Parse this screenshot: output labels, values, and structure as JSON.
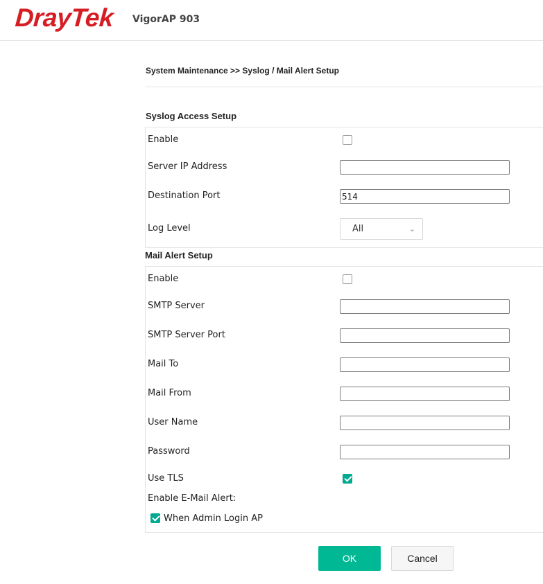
{
  "header": {
    "brand": "DrayTek",
    "model": "VigorAP 903"
  },
  "breadcrumb": "System Maintenance >> Syslog / Mail Alert Setup",
  "syslog": {
    "title": "Syslog Access Setup",
    "enable_label": "Enable",
    "enable_checked": false,
    "server_ip_label": "Server IP Address",
    "server_ip_value": "",
    "dest_port_label": "Destination Port",
    "dest_port_value": "514",
    "log_level_label": "Log Level",
    "log_level_value": "All"
  },
  "mail": {
    "title": "Mail Alert Setup",
    "enable_label": "Enable",
    "enable_checked": false,
    "smtp_server_label": "SMTP Server",
    "smtp_server_value": "",
    "smtp_port_label": "SMTP Server Port",
    "smtp_port_value": "",
    "mail_to_label": "Mail To",
    "mail_to_value": "",
    "mail_from_label": "Mail From",
    "mail_from_value": "",
    "user_name_label": "User Name",
    "user_name_value": "",
    "password_label": "Password",
    "password_value": "",
    "use_tls_label": "Use TLS",
    "use_tls_checked": true,
    "enable_alert_label": "Enable E-Mail Alert:",
    "admin_login_label": "When Admin Login AP",
    "admin_login_checked": true
  },
  "buttons": {
    "ok": "OK",
    "cancel": "Cancel"
  },
  "colors": {
    "brand_red": "#d71d24",
    "accent_green": "#00b894",
    "check_green": "#00a98f"
  }
}
